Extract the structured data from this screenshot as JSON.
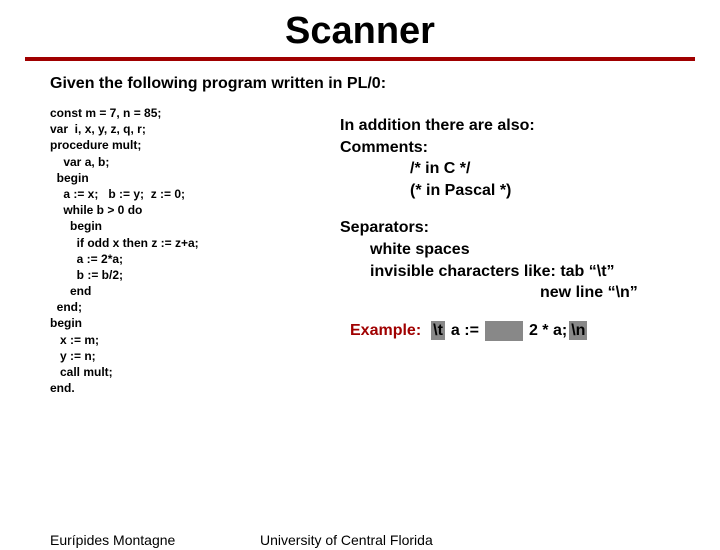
{
  "title": "Scanner",
  "intro": "Given the following program written in PL/0:",
  "code": "const m = 7, n = 85;\nvar  i, x, y, z, q, r;\nprocedure mult;\n    var a, b;\n  begin\n    a := x;   b := y;  z := 0;\n    while b > 0 do\n      begin\n        if odd x then z := z+a;\n        a := 2*a;\n        b := b/2;\n      end\n  end;\nbegin\n   x := m;\n   y := n;\n   call mult;\nend.",
  "right": {
    "also": "In addition there are also:",
    "comments": "Comments:",
    "c_comment": "/* in C */",
    "p_comment": "(* in Pascal *)",
    "separators": "Separators:",
    "whitespaces": "white spaces",
    "invisible": "invisible characters like: tab “\\t”",
    "newline": "new line “\\n”",
    "example_label": "Example:",
    "ex_t": "\\t",
    "ex_mid": "a :=",
    "ex_after": "2 *  a;",
    "ex_n": "\\n"
  },
  "footer": {
    "author": "Eurípides Montagne",
    "org": "University of Central Florida"
  }
}
